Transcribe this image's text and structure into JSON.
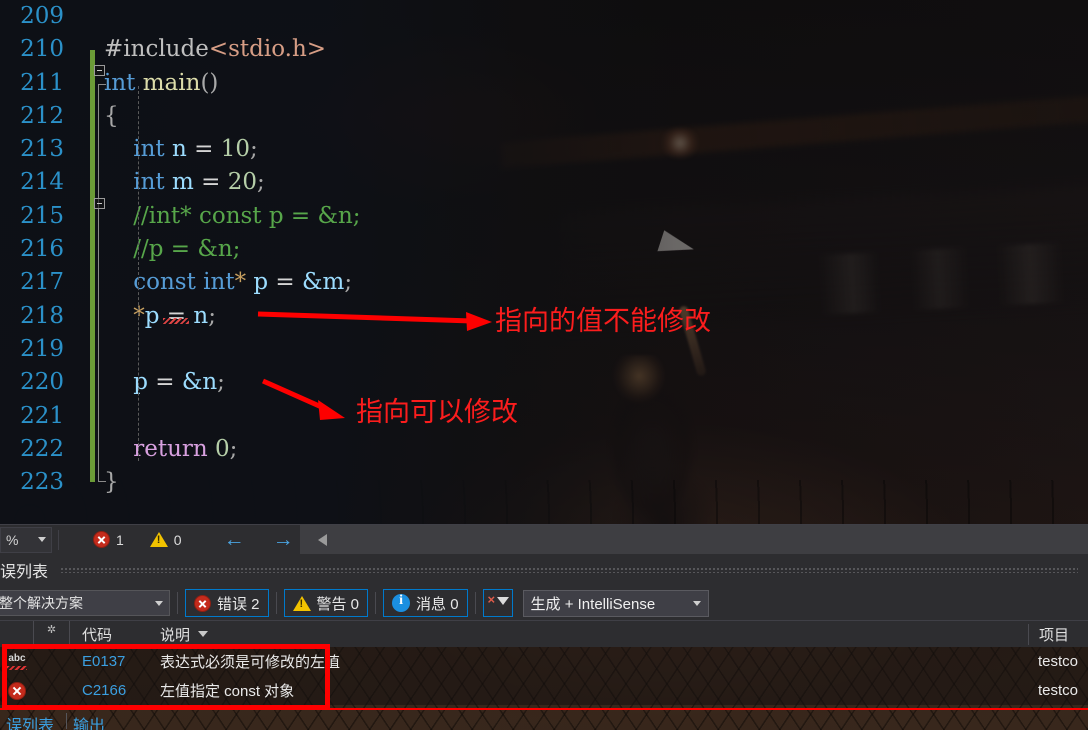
{
  "editor": {
    "line_numbers": [
      "209",
      "210",
      "211",
      "212",
      "213",
      "214",
      "215",
      "216",
      "217",
      "218",
      "219",
      "220",
      "221",
      "222",
      "223"
    ],
    "code_lines": [
      {
        "n": "209",
        "segments": []
      },
      {
        "n": "210",
        "segments": [
          {
            "t": "#include",
            "c": "pp"
          },
          {
            "t": "<stdio.h>",
            "c": "str"
          }
        ]
      },
      {
        "n": "211",
        "segments": [
          {
            "t": "int",
            "c": "kw"
          },
          {
            "t": " ",
            "c": "op"
          },
          {
            "t": "main",
            "c": "fn"
          },
          {
            "t": "()",
            "c": "punc"
          }
        ]
      },
      {
        "n": "212",
        "segments": [
          {
            "t": "{",
            "c": "punc"
          }
        ]
      },
      {
        "n": "213",
        "segments": [
          {
            "t": "    int",
            "c": "kw"
          },
          {
            "t": " ",
            "c": "op"
          },
          {
            "t": "n",
            "c": "var"
          },
          {
            "t": " = ",
            "c": "op"
          },
          {
            "t": "10",
            "c": "num"
          },
          {
            "t": ";",
            "c": "punc"
          }
        ]
      },
      {
        "n": "214",
        "segments": [
          {
            "t": "    int",
            "c": "kw"
          },
          {
            "t": " ",
            "c": "op"
          },
          {
            "t": "m",
            "c": "var"
          },
          {
            "t": " = ",
            "c": "op"
          },
          {
            "t": "20",
            "c": "num"
          },
          {
            "t": ";",
            "c": "punc"
          }
        ]
      },
      {
        "n": "215",
        "segments": [
          {
            "t": "    //int* const p = &n;",
            "c": "cmt"
          }
        ]
      },
      {
        "n": "216",
        "segments": [
          {
            "t": "    //p = &n;",
            "c": "cmt"
          }
        ]
      },
      {
        "n": "217",
        "segments": [
          {
            "t": "    const",
            "c": "kw"
          },
          {
            "t": " ",
            "c": "op"
          },
          {
            "t": "int",
            "c": "kw"
          },
          {
            "t": "*",
            "c": "opo"
          },
          {
            "t": " ",
            "c": "op"
          },
          {
            "t": "p",
            "c": "var"
          },
          {
            "t": " = ",
            "c": "op"
          },
          {
            "t": "&m",
            "c": "var"
          },
          {
            "t": ";",
            "c": "punc"
          }
        ]
      },
      {
        "n": "218",
        "segments": [
          {
            "t": "    *",
            "c": "opo"
          },
          {
            "t": "p",
            "c": "var"
          },
          {
            "t": " = ",
            "c": "op"
          },
          {
            "t": "n",
            "c": "var"
          },
          {
            "t": ";",
            "c": "punc"
          }
        ]
      },
      {
        "n": "219",
        "segments": []
      },
      {
        "n": "220",
        "segments": [
          {
            "t": "    p",
            "c": "var"
          },
          {
            "t": " = ",
            "c": "op"
          },
          {
            "t": "&n",
            "c": "var"
          },
          {
            "t": ";",
            "c": "punc"
          }
        ]
      },
      {
        "n": "221",
        "segments": []
      },
      {
        "n": "222",
        "segments": [
          {
            "t": "    return",
            "c": "ret"
          },
          {
            "t": " ",
            "c": "op"
          },
          {
            "t": "0",
            "c": "num"
          },
          {
            "t": ";",
            "c": "punc"
          }
        ]
      },
      {
        "n": "223",
        "segments": [
          {
            "t": "}",
            "c": "punc"
          }
        ]
      }
    ],
    "annotations": [
      {
        "id": "anno1",
        "text": "指向的值不能修改"
      },
      {
        "id": "anno2",
        "text": "指向可以修改"
      }
    ]
  },
  "navbar": {
    "zoom_value": "%",
    "error_count": "1",
    "warning_count": "0"
  },
  "panel": {
    "title": "误列表",
    "scope_value": "整个解决方案",
    "errors_label": "错误 2",
    "warnings_label": "警告 0",
    "messages_label": "消息 0",
    "build_filter_value": "生成 + IntelliSense",
    "columns": {
      "code": "代码",
      "description": "说明",
      "project": "项目"
    },
    "rows": [
      {
        "icon": "intellisense-squiggle-icon",
        "code": "E0137",
        "description": "表达式必须是可修改的左值",
        "project": "testco"
      },
      {
        "icon": "error-icon",
        "code": "C2166",
        "description": "左值指定 const 对象",
        "project": "testco"
      }
    ]
  },
  "bottom_tabs": [
    {
      "label": "误列表"
    },
    {
      "label": "输出"
    }
  ],
  "colors": {
    "accent_blue": "#007acc",
    "error_red": "#c42b1c",
    "warning_yellow": "#f2c300",
    "annotation_red": "#fe0000",
    "link_blue": "#3b9fe0"
  }
}
